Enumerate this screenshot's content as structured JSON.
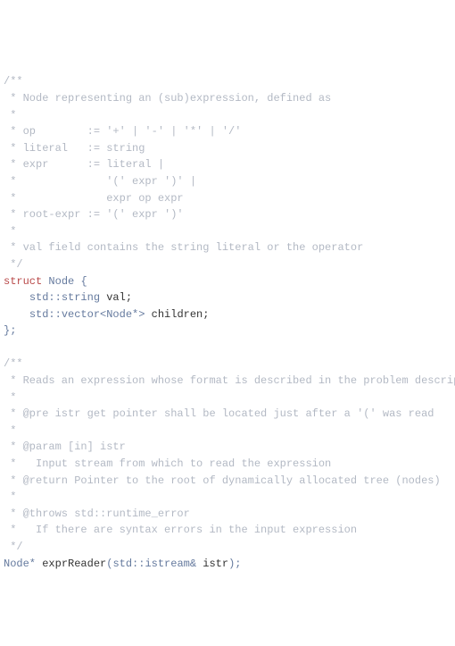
{
  "c1": "/**",
  "c2": " * Node representing an (sub)expression, defined as",
  "c3": " *",
  "c4": " * op        := '+' | '-' | '*' | '/'",
  "c5": " * literal   := string",
  "c6": " * expr      := literal |",
  "c7": " *              '(' expr ')' |",
  "c8": " *              expr op expr",
  "c9": " * root-expr := '(' expr ')'",
  "c10": " *",
  "c11": " * val field contains the string literal or the operator",
  "c12": " */",
  "kw_struct": "struct",
  "name_node": " Node ",
  "brace_open": "{",
  "indent1": "    ",
  "type_string": "std::string",
  "field_val": " val;",
  "type_vector": "std::vector<Node*>",
  "field_children": " children;",
  "brace_close": "};",
  "c13": "/**",
  "c14": " * Reads an expression whose format is described in the problem description.",
  "c15": " *",
  "c16": " * @pre istr get pointer shall be located just after a '(' was read",
  "c17": " *",
  "c18": " * @param [in] istr",
  "c19": " *   Input stream from which to read the expression",
  "c20": " * @return Pointer to the root of dynamically allocated tree (nodes)",
  "c21": " *",
  "c22": " * @throws std::runtime_error",
  "c23": " *   If there are syntax errors in the input expression",
  "c24": " */",
  "ret_type": "Node* ",
  "fn_name": "exprReader",
  "fn_sig_open": "(",
  "param_type": "std::istream&",
  "param_name": " istr",
  "fn_sig_close": ");"
}
